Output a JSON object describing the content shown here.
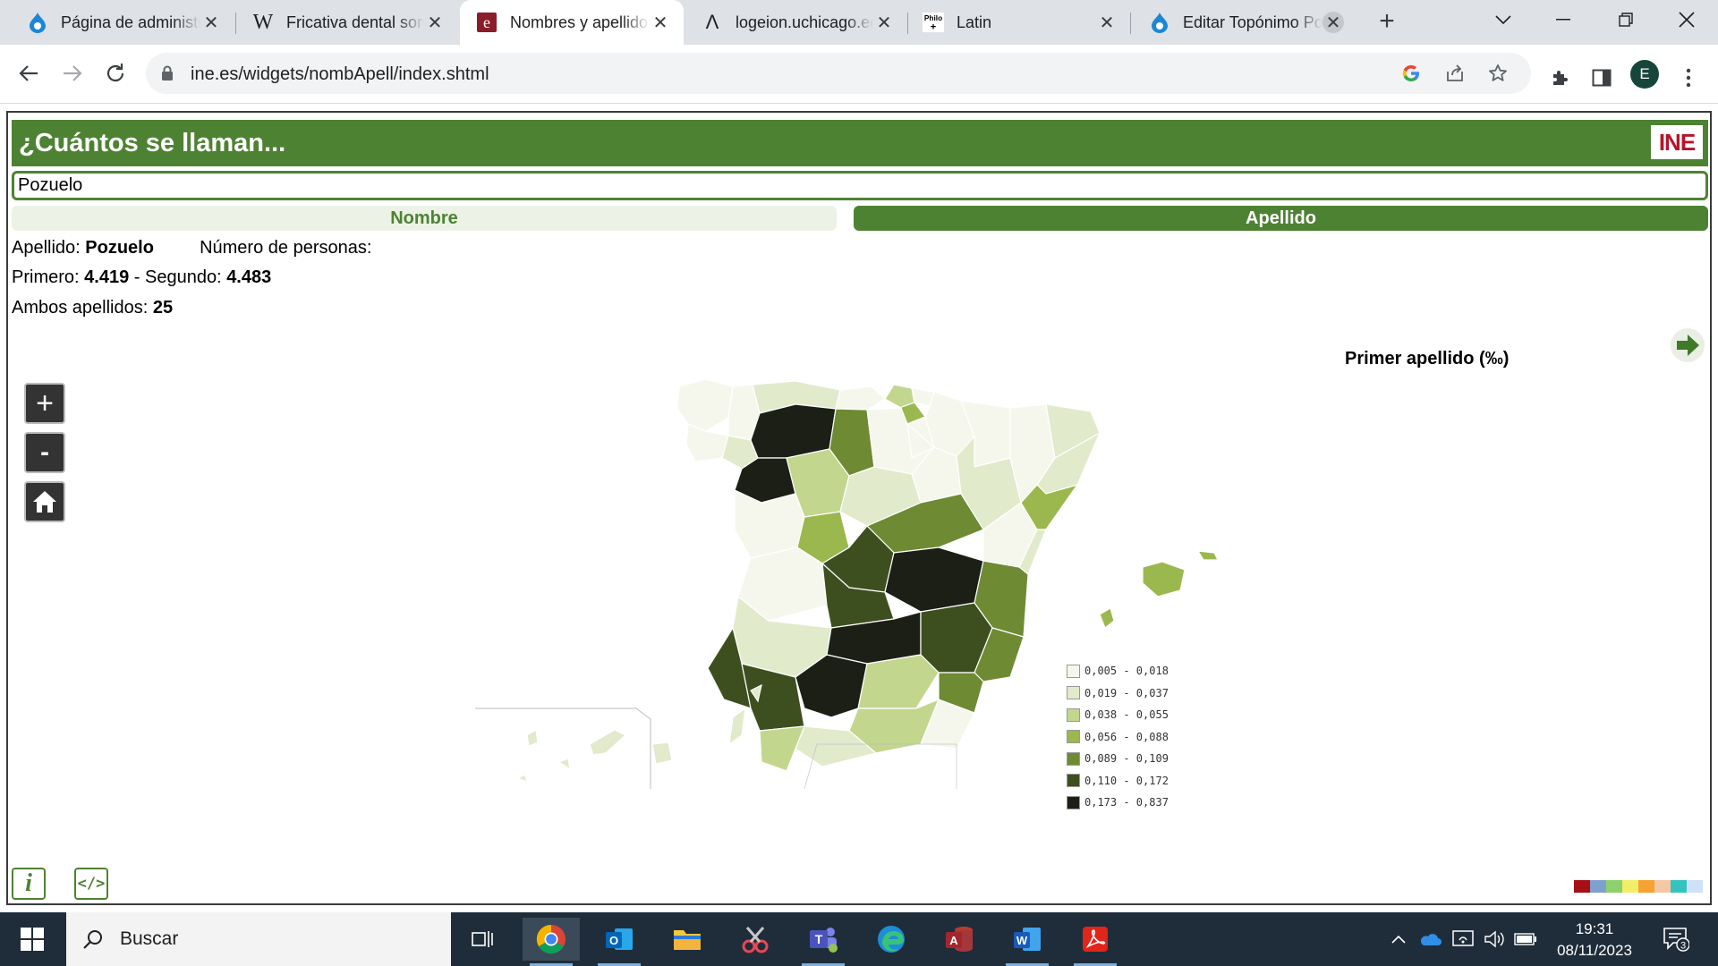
{
  "browser": {
    "tabs": [
      {
        "title": "Página de administración",
        "icon": "drupal-icon",
        "active": false
      },
      {
        "title": "Fricativa dental sorda",
        "icon": "wikipedia-icon",
        "active": false
      },
      {
        "title": "Nombres y apellidos",
        "icon": "etymology-icon",
        "active": true
      },
      {
        "title": "logeion.uchicago.edu",
        "icon": "lambda-icon",
        "active": false
      },
      {
        "title": "Latin",
        "icon": "philo-icon",
        "active": false
      },
      {
        "title": "Editar Topónimo Pozuelo",
        "icon": "drupal-icon",
        "active": false
      }
    ],
    "new_tab": "+",
    "url": "ine.es/widgets/nombApell/index.shtml",
    "avatar_letter": "E"
  },
  "widget": {
    "header_title": "¿Cuántos se llaman...",
    "logo_text": "INE",
    "search_value": "Pozuelo",
    "toggle_nombre": "Nombre",
    "toggle_apellido": "Apellido",
    "result": {
      "apellido_label": "Apellido:",
      "apellido_value": "Pozuelo",
      "personas_label": "Número de personas:",
      "primero_label": "Primero:",
      "primero_value": "4.419",
      "segundo_label": "- Segundo:",
      "segundo_value": "4.483",
      "ambos_label": "Ambos apellidos:",
      "ambos_value": "25"
    },
    "map_title": "Primer apellido (‰)",
    "map_controls": {
      "zoom_in": "+",
      "zoom_out": "-"
    },
    "legend": [
      {
        "label": "0,005 - 0,018",
        "color": "#f5f7ec"
      },
      {
        "label": "0,019 - 0,037",
        "color": "#e1eacb"
      },
      {
        "label": "0,038 - 0,055",
        "color": "#c3d68e"
      },
      {
        "label": "0,056 - 0,088",
        "color": "#9ab84d"
      },
      {
        "label": "0,089 - 0,109",
        "color": "#6e8a33"
      },
      {
        "label": "0,110 - 0,172",
        "color": "#3e4f1f"
      },
      {
        "label": "0,173 - 0,837",
        "color": "#1c1f16"
      }
    ],
    "color_strip": [
      "#a50f15",
      "#7fa0cf",
      "#8ecf6e",
      "#f2ee6a",
      "#f7a234",
      "#f4c7a5",
      "#35c3c0",
      "#cfe0f7"
    ]
  },
  "taskbar": {
    "search_placeholder": "Buscar",
    "time": "19:31",
    "date": "08/11/2023",
    "notification_count": "3"
  }
}
